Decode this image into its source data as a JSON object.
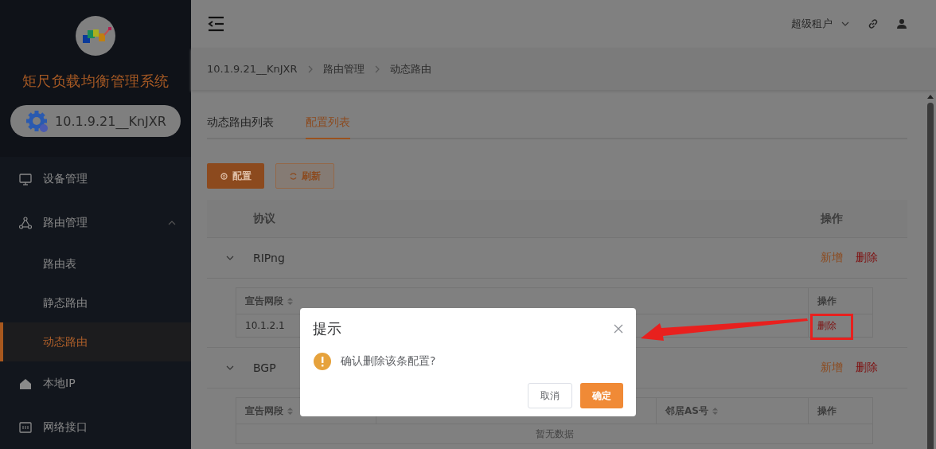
{
  "sidebar": {
    "title": "矩尺负载均衡管理系统",
    "device": "10.1.9.21__KnJXR",
    "menu": [
      {
        "label": "设备管理",
        "kind": "item",
        "selected": false
      },
      {
        "label": "路由管理",
        "kind": "group",
        "expanded": true,
        "children": [
          {
            "label": "路由表",
            "selected": false
          },
          {
            "label": "静态路由",
            "selected": false
          },
          {
            "label": "动态路由",
            "selected": true
          }
        ]
      },
      {
        "label": "本地IP",
        "kind": "item",
        "selected": false
      },
      {
        "label": "网络接口",
        "kind": "item",
        "selected": false
      }
    ]
  },
  "header": {
    "tenant": "超级租户"
  },
  "breadcrumb": [
    "10.1.9.21__KnJXR",
    "路由管理",
    "动态路由"
  ],
  "tabs": [
    {
      "label": "动态路由列表",
      "selected": false
    },
    {
      "label": "配置列表",
      "selected": true
    }
  ],
  "toolbar": [
    {
      "label": "配置",
      "kind": "primary"
    },
    {
      "label": "刷新",
      "kind": "plain"
    }
  ],
  "table": {
    "columns": [
      "协议",
      "操作"
    ],
    "rows": [
      {
        "protocol": "RIPng",
        "expanded": true,
        "actions": [
          "新增",
          "删除"
        ],
        "subtable": {
          "columns": [
            {
              "label": "宣告网段",
              "sortable": true
            },
            {
              "label": "操作",
              "sortable": false
            }
          ],
          "rows": [
            [
              "10.1.2.1",
              "删除"
            ]
          ]
        }
      },
      {
        "protocol": "BGP",
        "expanded": true,
        "actions": [
          "新增",
          "删除"
        ],
        "subtable": {
          "columns": [
            {
              "label": "宣告网段",
              "sortable": true
            },
            {
              "label": "邻居AS号",
              "sortable": true
            },
            {
              "label": "操作",
              "sortable": false
            }
          ],
          "empty_text": "暂无数据"
        }
      }
    ]
  },
  "dialog": {
    "title": "提示",
    "message": "确认删除该条配置?",
    "buttons": [
      {
        "label": "取消",
        "kind": "plain"
      },
      {
        "label": "确定",
        "kind": "primary"
      }
    ]
  }
}
